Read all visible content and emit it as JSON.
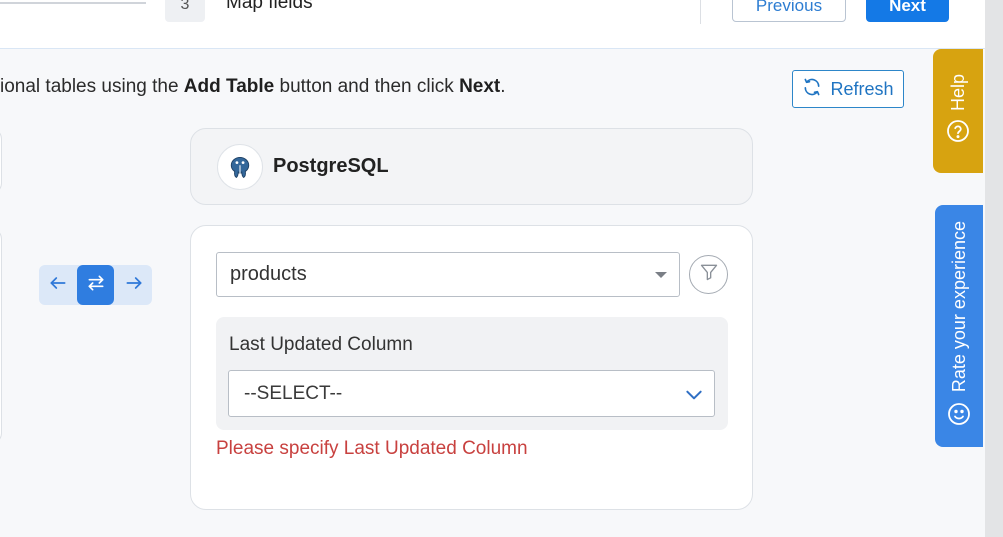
{
  "stepper": {
    "step_number": "3",
    "step_label": "Map fields",
    "previous_label": "Previous",
    "next_label": "Next"
  },
  "instruction": {
    "part1": "ional tables using the ",
    "bold1": "Add Table",
    "part2": " button and then click ",
    "bold2": "Next",
    "part3": "."
  },
  "refresh_label": "Refresh",
  "destination": {
    "name": "PostgreSQL",
    "table_value": "products",
    "last_updated_label": "Last Updated Column",
    "last_updated_value": "--SELECT--",
    "error": "Please specify Last Updated Column"
  },
  "side_tabs": {
    "help": "Help",
    "rate": "Rate your experience"
  },
  "icons": {
    "refresh": "refresh-icon",
    "left_arrow": "arrow-left-icon",
    "both_arrows": "arrows-swap-icon",
    "right_arrow": "arrow-right-icon",
    "db_logo": "postgresql-logo",
    "filter": "filter-icon",
    "chevron": "chevron-down-icon",
    "help": "question-circle-icon",
    "rate": "smiley-icon"
  },
  "colors": {
    "primary": "#1479e6",
    "help_tab": "#d7a310",
    "rate_tab": "#3a86e6",
    "error": "#c8413f"
  }
}
